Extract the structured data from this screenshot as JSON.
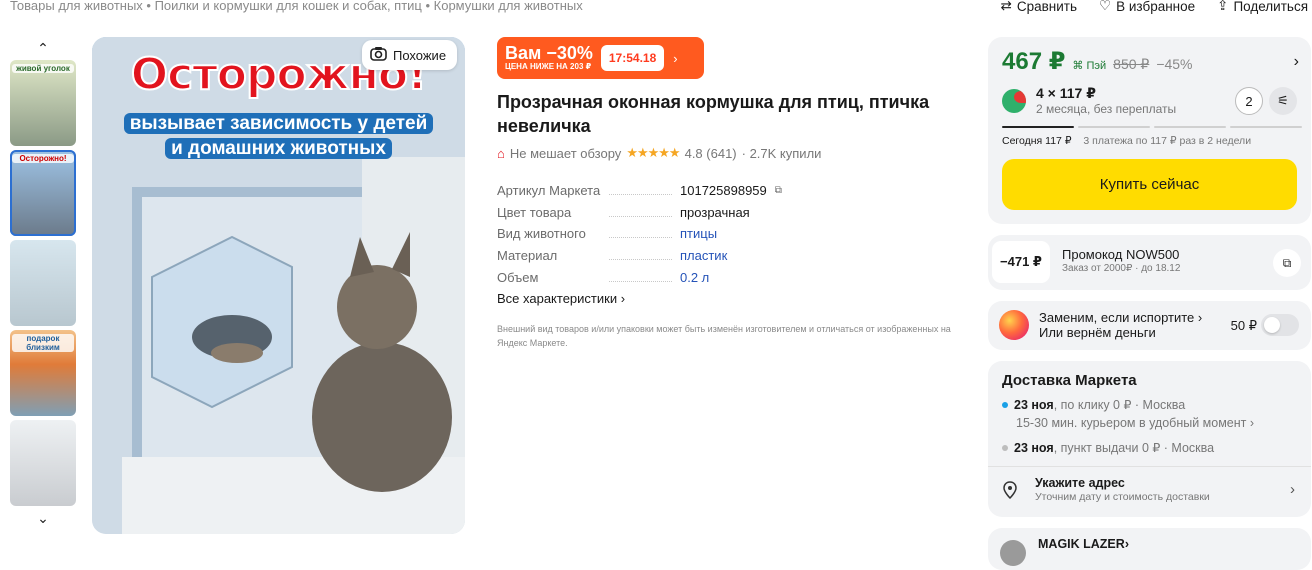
{
  "breadcrumb": "Товары для животных • Поилки и кормушки для кошек и собак, птиц • Кормушки для животных",
  "top_actions": {
    "compare": "Сравнить",
    "favorite": "В избранное",
    "share": "Поделиться"
  },
  "gallery": {
    "similar_label": "Похожие",
    "promo_headline": "Осторожно!",
    "promo_sub_line1": "вызывает зависимость у детей",
    "promo_sub_line2": "и домашних животных",
    "thumb_labels": [
      "живой уголок",
      "Осторожно!",
      "",
      "подарок близким",
      ""
    ]
  },
  "deal": {
    "discount": "Вам −30%",
    "subtext": "ЦЕНА НИЖЕ НА 203 ₽",
    "timer": "17:54.18"
  },
  "product": {
    "title": "Прозрачная оконная кормушка для птиц, птичка невеличка",
    "badge": "Не мешает обзору",
    "stars": "★★★★★",
    "rating": "4.8 (641)",
    "sold": "· 2.7K купили"
  },
  "specs": [
    {
      "key": "Артикул Маркета",
      "value": "101725898959"
    },
    {
      "key": "Цвет товара",
      "value": "прозрачная"
    },
    {
      "key": "Вид животного",
      "value": "птицы"
    },
    {
      "key": "Материал",
      "value": "пластик"
    },
    {
      "key": "Объем",
      "value": "0.2 л"
    }
  ],
  "all_specs_label": "Все характеристики",
  "disclaimer": "Внешний вид товаров и/или упаковки может быть изменён изготовителем и отличаться от изображенных на Яндекс Маркете.",
  "price": {
    "current": "467 ₽",
    "pay_label": "Пэй",
    "old": "850 ₽",
    "discount": "−45%",
    "split_amount": "4 × 117 ₽",
    "split_note": "2 месяца, без переплаты",
    "split_count": "2",
    "today": "Сегодня 117 ₽",
    "schedule": "3 платежа по 117 ₽ раз в 2 недели",
    "buy_label": "Купить сейчас"
  },
  "promo": {
    "amount": "−471 ₽",
    "code_label": "Промокод NOW500",
    "condition": "Заказ от 2000₽ · до 18.12"
  },
  "replace": {
    "line1": "Заменим, если испортите",
    "line2": "Или вернём деньги",
    "price": "50 ₽"
  },
  "delivery": {
    "title": "Доставка Маркета",
    "option1_date": "23 ноя",
    "option1_rest": ", по клику 0 ₽ · Москва",
    "option1_note": "15-30 мин. курьером в удобный момент",
    "option2_date": "23 ноя",
    "option2_rest": ", пункт выдачи 0 ₽ · Москва",
    "address_title": "Укажите адрес",
    "address_note": "Уточним дату и стоимость доставки"
  },
  "seller": {
    "name": "MAGIK LAZER"
  },
  "colors": {
    "price_green": "#1c7a33",
    "buy_yellow": "#ffdc00",
    "deal_orange": "#ff5a1f",
    "link_blue": "#2553b8"
  }
}
